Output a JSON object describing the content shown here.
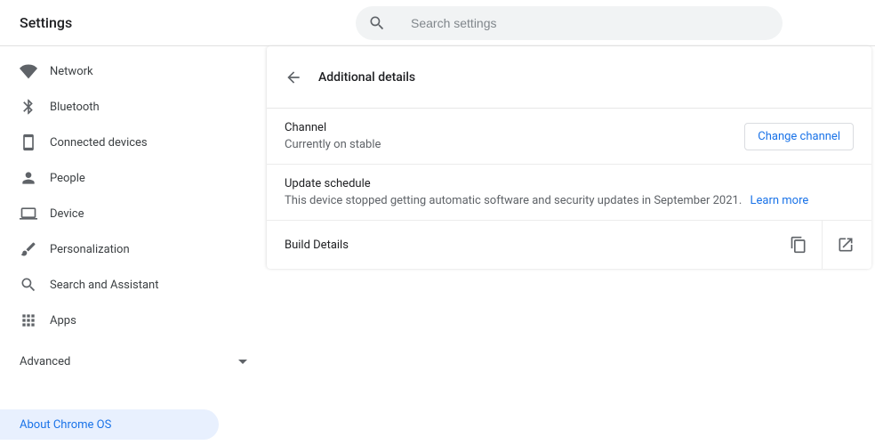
{
  "header": {
    "title": "Settings",
    "search_placeholder": "Search settings"
  },
  "sidebar": {
    "items": [
      {
        "id": "network",
        "label": "Network",
        "icon": "wifi-icon"
      },
      {
        "id": "bluetooth",
        "label": "Bluetooth",
        "icon": "bluetooth-icon"
      },
      {
        "id": "connected",
        "label": "Connected devices",
        "icon": "devices-icon"
      },
      {
        "id": "people",
        "label": "People",
        "icon": "person-icon"
      },
      {
        "id": "device",
        "label": "Device",
        "icon": "laptop-icon"
      },
      {
        "id": "personalization",
        "label": "Personalization",
        "icon": "brush-icon"
      },
      {
        "id": "search",
        "label": "Search and Assistant",
        "icon": "search-icon"
      },
      {
        "id": "apps",
        "label": "Apps",
        "icon": "apps-icon"
      }
    ],
    "advanced_label": "Advanced",
    "about_label": "About Chrome OS"
  },
  "main": {
    "page_title": "Additional details",
    "channel": {
      "title": "Channel",
      "subtitle": "Currently on stable",
      "button": "Change channel"
    },
    "update": {
      "title": "Update schedule",
      "subtitle": "This device stopped getting automatic software and security updates in September 2021.",
      "learn_more": "Learn more"
    },
    "build": {
      "title": "Build Details"
    }
  }
}
